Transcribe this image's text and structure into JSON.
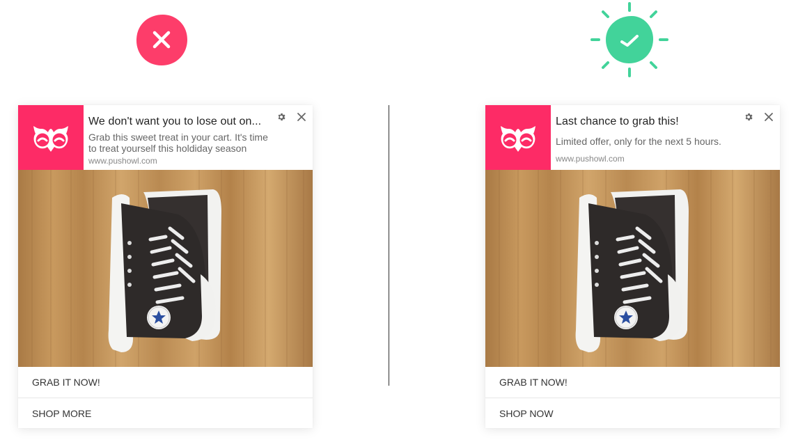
{
  "left_example": {
    "status": "bad",
    "status_icon": "x-icon",
    "status_color": "#fd3d6a",
    "notification": {
      "title": "We don't want you to lose out on...",
      "body": "Grab this sweet treat in your cart. It's time to treat yourself this holdiday season",
      "site": "www.pushowl.com",
      "actions": [
        "GRAB IT NOW!",
        "SHOP MORE"
      ]
    }
  },
  "right_example": {
    "status": "good",
    "status_icon": "check-icon",
    "status_color": "#42d39a",
    "notification": {
      "title": "Last chance to grab this!",
      "body": "Limited offer, only for the next 5 hours.",
      "site": "www.pushowl.com",
      "actions": [
        "GRAB IT NOW!",
        "SHOP NOW"
      ]
    }
  },
  "brand_color": "#fd2b66",
  "logo_icon": "owl-logo-icon",
  "settings_icon": "gear-icon",
  "dismiss_icon": "close-icon",
  "hero_image": "black-high-top-sneakers-on-wooden-floor"
}
